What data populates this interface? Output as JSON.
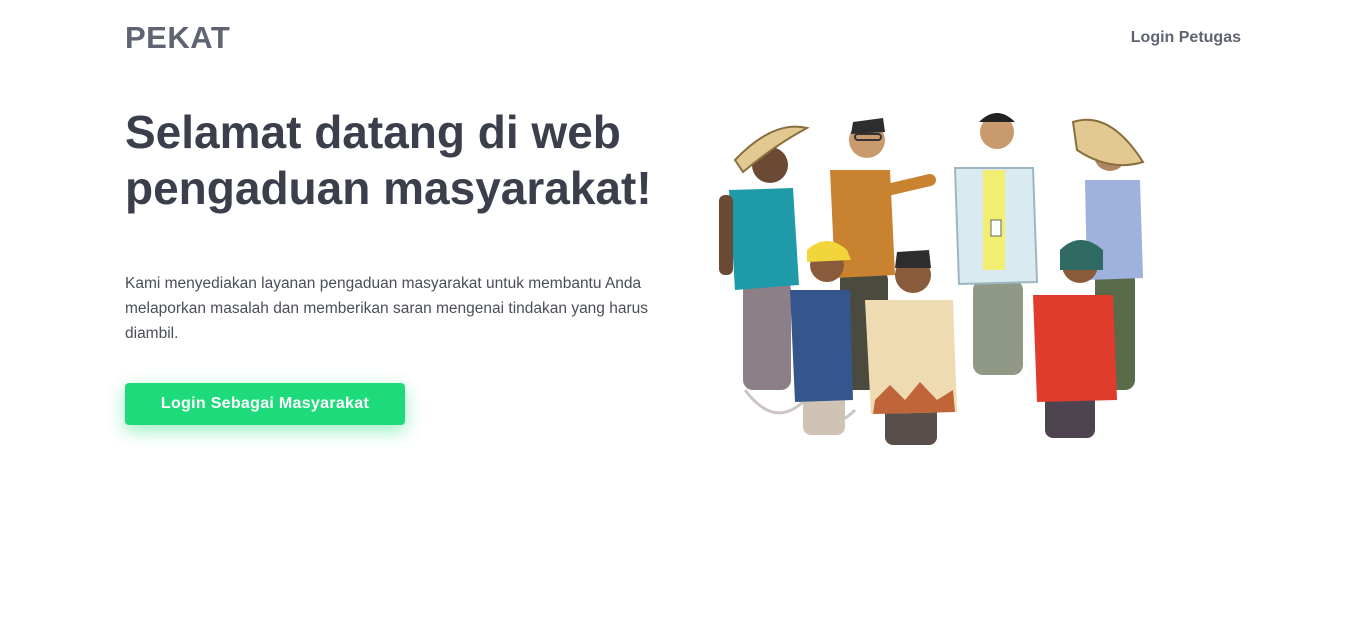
{
  "header": {
    "brand": "PEKAT",
    "login_link": "Login Petugas"
  },
  "hero": {
    "title": "Selamat datang di web pengaduan masyarakat!",
    "description": "Kami menyediakan layanan pengaduan masyarakat untuk membantu Anda melaporkan masalah dan memberikan saran mengenai tindakan yang harus diambil.",
    "cta_label": "Login Sebagai Masyarakat"
  },
  "colors": {
    "brand_text": "#5f6473",
    "title_text": "#3a3f4b",
    "cta_background": "#1ddb7b",
    "cta_text": "#ffffff"
  }
}
